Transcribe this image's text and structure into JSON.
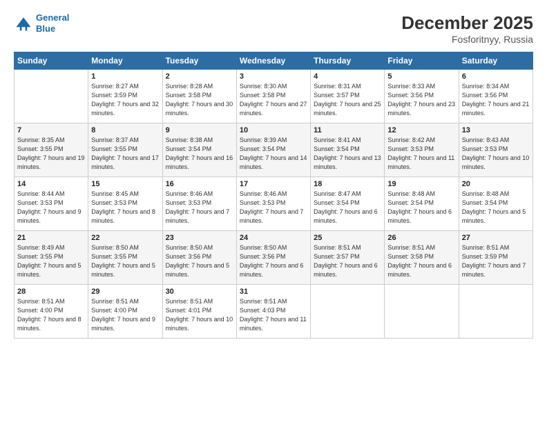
{
  "logo": {
    "line1": "General",
    "line2": "Blue"
  },
  "title": "December 2025",
  "location": "Fosforitnyy, Russia",
  "days_of_week": [
    "Sunday",
    "Monday",
    "Tuesday",
    "Wednesday",
    "Thursday",
    "Friday",
    "Saturday"
  ],
  "weeks": [
    [
      {
        "day": "",
        "sunrise": "",
        "sunset": "",
        "daylight": ""
      },
      {
        "day": "1",
        "sunrise": "Sunrise: 8:27 AM",
        "sunset": "Sunset: 3:59 PM",
        "daylight": "Daylight: 7 hours and 32 minutes."
      },
      {
        "day": "2",
        "sunrise": "Sunrise: 8:28 AM",
        "sunset": "Sunset: 3:58 PM",
        "daylight": "Daylight: 7 hours and 30 minutes."
      },
      {
        "day": "3",
        "sunrise": "Sunrise: 8:30 AM",
        "sunset": "Sunset: 3:58 PM",
        "daylight": "Daylight: 7 hours and 27 minutes."
      },
      {
        "day": "4",
        "sunrise": "Sunrise: 8:31 AM",
        "sunset": "Sunset: 3:57 PM",
        "daylight": "Daylight: 7 hours and 25 minutes."
      },
      {
        "day": "5",
        "sunrise": "Sunrise: 8:33 AM",
        "sunset": "Sunset: 3:56 PM",
        "daylight": "Daylight: 7 hours and 23 minutes."
      },
      {
        "day": "6",
        "sunrise": "Sunrise: 8:34 AM",
        "sunset": "Sunset: 3:56 PM",
        "daylight": "Daylight: 7 hours and 21 minutes."
      }
    ],
    [
      {
        "day": "7",
        "sunrise": "Sunrise: 8:35 AM",
        "sunset": "Sunset: 3:55 PM",
        "daylight": "Daylight: 7 hours and 19 minutes."
      },
      {
        "day": "8",
        "sunrise": "Sunrise: 8:37 AM",
        "sunset": "Sunset: 3:55 PM",
        "daylight": "Daylight: 7 hours and 17 minutes."
      },
      {
        "day": "9",
        "sunrise": "Sunrise: 8:38 AM",
        "sunset": "Sunset: 3:54 PM",
        "daylight": "Daylight: 7 hours and 16 minutes."
      },
      {
        "day": "10",
        "sunrise": "Sunrise: 8:39 AM",
        "sunset": "Sunset: 3:54 PM",
        "daylight": "Daylight: 7 hours and 14 minutes."
      },
      {
        "day": "11",
        "sunrise": "Sunrise: 8:41 AM",
        "sunset": "Sunset: 3:54 PM",
        "daylight": "Daylight: 7 hours and 13 minutes."
      },
      {
        "day": "12",
        "sunrise": "Sunrise: 8:42 AM",
        "sunset": "Sunset: 3:53 PM",
        "daylight": "Daylight: 7 hours and 11 minutes."
      },
      {
        "day": "13",
        "sunrise": "Sunrise: 8:43 AM",
        "sunset": "Sunset: 3:53 PM",
        "daylight": "Daylight: 7 hours and 10 minutes."
      }
    ],
    [
      {
        "day": "14",
        "sunrise": "Sunrise: 8:44 AM",
        "sunset": "Sunset: 3:53 PM",
        "daylight": "Daylight: 7 hours and 9 minutes."
      },
      {
        "day": "15",
        "sunrise": "Sunrise: 8:45 AM",
        "sunset": "Sunset: 3:53 PM",
        "daylight": "Daylight: 7 hours and 8 minutes."
      },
      {
        "day": "16",
        "sunrise": "Sunrise: 8:46 AM",
        "sunset": "Sunset: 3:53 PM",
        "daylight": "Daylight: 7 hours and 7 minutes."
      },
      {
        "day": "17",
        "sunrise": "Sunrise: 8:46 AM",
        "sunset": "Sunset: 3:53 PM",
        "daylight": "Daylight: 7 hours and 7 minutes."
      },
      {
        "day": "18",
        "sunrise": "Sunrise: 8:47 AM",
        "sunset": "Sunset: 3:54 PM",
        "daylight": "Daylight: 7 hours and 6 minutes."
      },
      {
        "day": "19",
        "sunrise": "Sunrise: 8:48 AM",
        "sunset": "Sunset: 3:54 PM",
        "daylight": "Daylight: 7 hours and 6 minutes."
      },
      {
        "day": "20",
        "sunrise": "Sunrise: 8:48 AM",
        "sunset": "Sunset: 3:54 PM",
        "daylight": "Daylight: 7 hours and 5 minutes."
      }
    ],
    [
      {
        "day": "21",
        "sunrise": "Sunrise: 8:49 AM",
        "sunset": "Sunset: 3:55 PM",
        "daylight": "Daylight: 7 hours and 5 minutes."
      },
      {
        "day": "22",
        "sunrise": "Sunrise: 8:50 AM",
        "sunset": "Sunset: 3:55 PM",
        "daylight": "Daylight: 7 hours and 5 minutes."
      },
      {
        "day": "23",
        "sunrise": "Sunrise: 8:50 AM",
        "sunset": "Sunset: 3:56 PM",
        "daylight": "Daylight: 7 hours and 5 minutes."
      },
      {
        "day": "24",
        "sunrise": "Sunrise: 8:50 AM",
        "sunset": "Sunset: 3:56 PM",
        "daylight": "Daylight: 7 hours and 6 minutes."
      },
      {
        "day": "25",
        "sunrise": "Sunrise: 8:51 AM",
        "sunset": "Sunset: 3:57 PM",
        "daylight": "Daylight: 7 hours and 6 minutes."
      },
      {
        "day": "26",
        "sunrise": "Sunrise: 8:51 AM",
        "sunset": "Sunset: 3:58 PM",
        "daylight": "Daylight: 7 hours and 6 minutes."
      },
      {
        "day": "27",
        "sunrise": "Sunrise: 8:51 AM",
        "sunset": "Sunset: 3:59 PM",
        "daylight": "Daylight: 7 hours and 7 minutes."
      }
    ],
    [
      {
        "day": "28",
        "sunrise": "Sunrise: 8:51 AM",
        "sunset": "Sunset: 4:00 PM",
        "daylight": "Daylight: 7 hours and 8 minutes."
      },
      {
        "day": "29",
        "sunrise": "Sunrise: 8:51 AM",
        "sunset": "Sunset: 4:00 PM",
        "daylight": "Daylight: 7 hours and 9 minutes."
      },
      {
        "day": "30",
        "sunrise": "Sunrise: 8:51 AM",
        "sunset": "Sunset: 4:01 PM",
        "daylight": "Daylight: 7 hours and 10 minutes."
      },
      {
        "day": "31",
        "sunrise": "Sunrise: 8:51 AM",
        "sunset": "Sunset: 4:03 PM",
        "daylight": "Daylight: 7 hours and 11 minutes."
      },
      {
        "day": "",
        "sunrise": "",
        "sunset": "",
        "daylight": ""
      },
      {
        "day": "",
        "sunrise": "",
        "sunset": "",
        "daylight": ""
      },
      {
        "day": "",
        "sunrise": "",
        "sunset": "",
        "daylight": ""
      }
    ]
  ]
}
